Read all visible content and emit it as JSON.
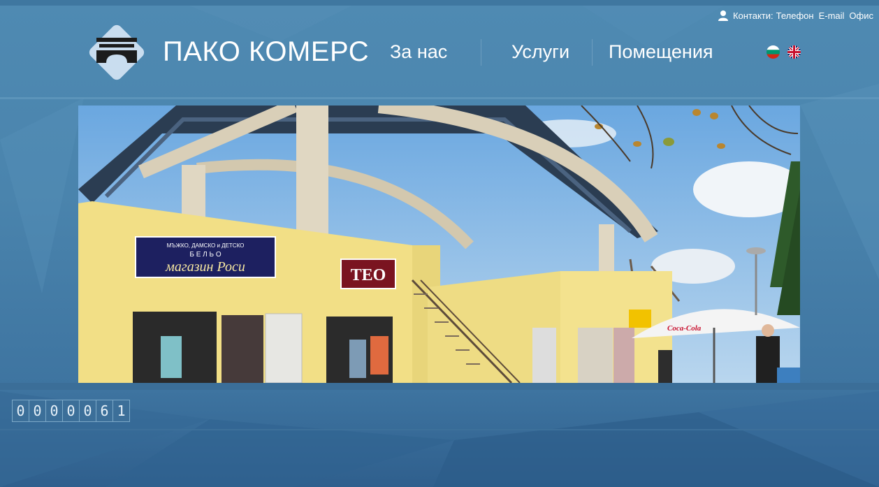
{
  "header": {
    "contacts_label": "Контакти:",
    "contact_links": [
      "Телефон",
      "E-mail",
      "Офис"
    ],
    "brand": "ПАКО КОМЕРС"
  },
  "nav": {
    "items": [
      "За нас",
      "Услуги",
      "Помещения"
    ]
  },
  "languages": [
    {
      "code": "bg",
      "icon": "bulgarian-flag-icon"
    },
    {
      "code": "en",
      "icon": "uk-flag-icon"
    }
  ],
  "banner": {
    "sign_top": "МЪЖКО, ДАМСКО и ДЕТСКО",
    "sign_mid": "Б Е Л Ь О",
    "sign_main": "магазин Роси",
    "sign_teo": "ТЕО",
    "coca_cola": "Coca-Cola"
  },
  "counter": {
    "digits": [
      "0",
      "0",
      "0",
      "0",
      "0",
      "6",
      "1"
    ]
  },
  "colors": {
    "background": "#4f8ab2",
    "text": "#ffffff",
    "accent_dark": "#2f5f8d"
  }
}
